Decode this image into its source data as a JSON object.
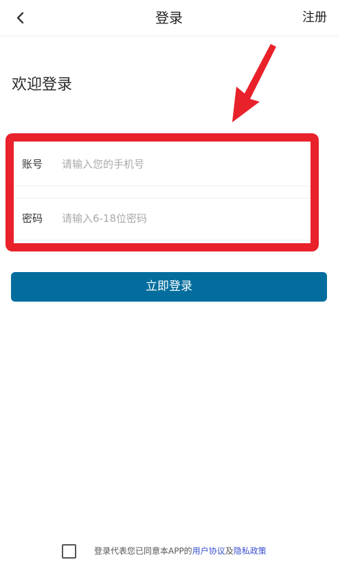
{
  "header": {
    "title": "登录",
    "register_label": "注册",
    "back_icon": "chevron-left-icon"
  },
  "welcome_text": "欢迎登录",
  "form": {
    "account": {
      "label": "账号",
      "placeholder": "请输入您的手机号",
      "value": ""
    },
    "password": {
      "label": "密码",
      "placeholder": "请输入6-18位密码",
      "value": ""
    }
  },
  "login_button_label": "立即登录",
  "agreement": {
    "checked": false,
    "prefix_text": "登录代表您已同意本APP的",
    "user_agreement": "用户协议",
    "conjunction": "及",
    "privacy_policy": "隐私政策"
  },
  "annotation": {
    "arrow_color": "#e8212a",
    "frame_color": "#e8212a"
  },
  "colors": {
    "primary": "#036e9e",
    "link": "#3a4fd0"
  }
}
